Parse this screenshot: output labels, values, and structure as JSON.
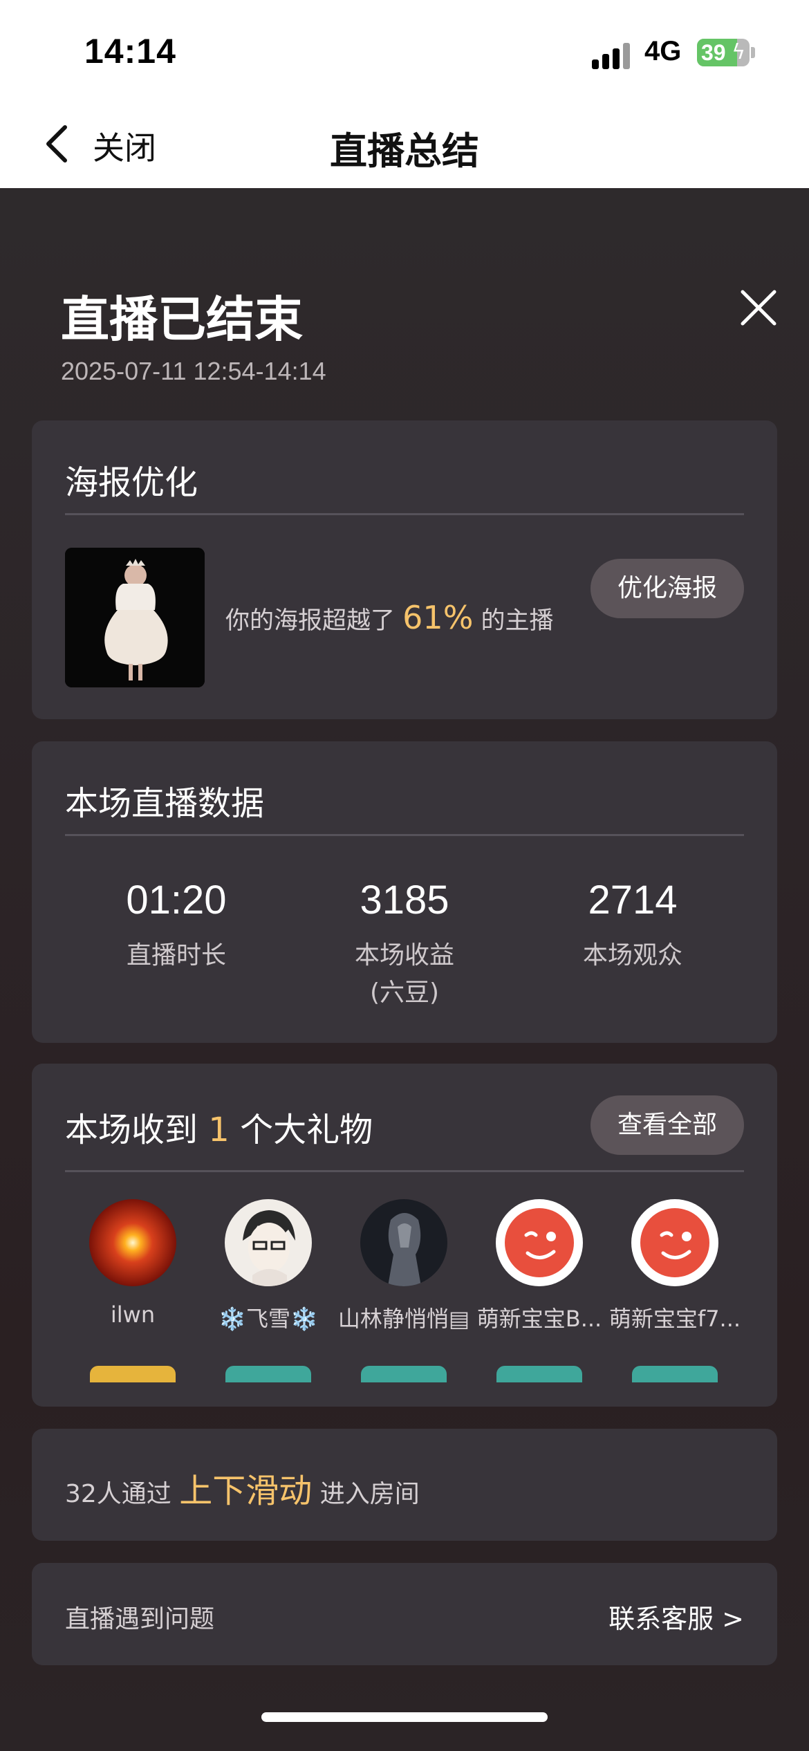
{
  "status_bar": {
    "time": "14:14",
    "network": "4G",
    "battery": "39",
    "battery_level_percent": 39
  },
  "nav": {
    "back_label": "关闭",
    "title": "直播总结"
  },
  "header": {
    "title": "直播已结束",
    "date_range": "2025-07-11 12:54-14:14"
  },
  "poster": {
    "title": "海报优化",
    "text_before": "你的海报超越了",
    "percent": "61%",
    "text_after": "的主播",
    "button": "优化海报"
  },
  "stats": {
    "title": "本场直播数据",
    "items": [
      {
        "value": "01:20",
        "label": "直播时长",
        "sub": ""
      },
      {
        "value": "3185",
        "label": "本场收益",
        "sub": "(六豆)"
      },
      {
        "value": "2714",
        "label": "本场观众",
        "sub": ""
      }
    ]
  },
  "gifts": {
    "title_before": "本场收到",
    "count": "1",
    "title_after": "个大礼物",
    "view_all": "查看全部",
    "donors": [
      {
        "name": "ilwn",
        "avatar": "sunburst-avatar",
        "badge_color": "#e6b43c"
      },
      {
        "name": "❄️飞雪❄️",
        "avatar": "cartoon-avatar",
        "badge_color": "#3fa79b"
      },
      {
        "name": "山林静悄悄▤",
        "avatar": "dark-figure-avatar",
        "badge_color": "#3fa79b"
      },
      {
        "name": "萌新宝宝B...",
        "avatar": "wink-face-avatar",
        "badge_color": "#3fa79b"
      },
      {
        "name": "萌新宝宝f7...",
        "avatar": "wink-face-avatar",
        "badge_color": "#3fa79b"
      }
    ]
  },
  "slide": {
    "text_before": "32人通过",
    "highlight": "上下滑动",
    "text_after": "进入房间"
  },
  "help": {
    "left": "直播遇到问题",
    "right": "联系客服 >"
  },
  "colors": {
    "accent": "#f6c36b",
    "card": "#38343a",
    "button": "#5c5459"
  }
}
